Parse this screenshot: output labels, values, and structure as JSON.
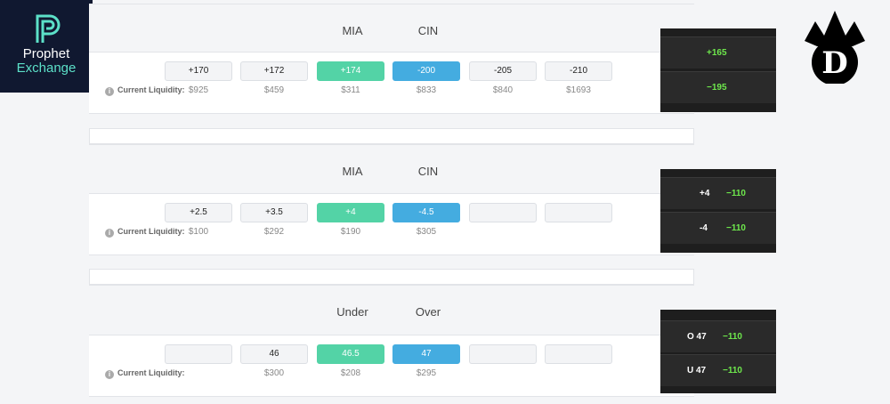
{
  "brand": {
    "prophet_line1": "Prophet",
    "prophet_line2": "Exchange",
    "prophet_color": "#5ce0c8",
    "dk_logo_letter": "D",
    "dk_icon": "crown-icon"
  },
  "colors": {
    "accent_green": "#53d3a6",
    "accent_blue": "#44ace0",
    "dk_green": "#6ee84c"
  },
  "markets": [
    {
      "team_a": "MIA",
      "team_b": "CIN",
      "buttons": [
        "+170",
        "+172",
        "+174",
        "-200",
        "-205",
        "-210"
      ],
      "liquidity_label": "Current Liquidity:",
      "liquidity": [
        "$925",
        "$459",
        "$311",
        "$833",
        "$840",
        "$1693"
      ],
      "dk": [
        {
          "line": "",
          "odds": "+165"
        },
        {
          "line": "",
          "odds": "−195"
        }
      ]
    },
    {
      "team_a": "MIA",
      "team_b": "CIN",
      "buttons": [
        "+2.5",
        "+3.5",
        "+4",
        "-4.5",
        "",
        ""
      ],
      "liquidity_label": "Current Liquidity:",
      "liquidity": [
        "$100",
        "$292",
        "$190",
        "$305",
        "",
        ""
      ],
      "dk": [
        {
          "line": "+4",
          "odds": "−110"
        },
        {
          "line": "-4",
          "odds": "−110"
        }
      ]
    },
    {
      "team_a": "Under",
      "team_b": "Over",
      "buttons": [
        "",
        "46",
        "46.5",
        "47",
        "",
        ""
      ],
      "liquidity_label": "Current Liquidity:",
      "liquidity": [
        "",
        "$300",
        "$208",
        "$295",
        "",
        ""
      ],
      "dk": [
        {
          "line": "O 47",
          "odds": "−110"
        },
        {
          "line": "U 47",
          "odds": "−110"
        }
      ]
    }
  ]
}
